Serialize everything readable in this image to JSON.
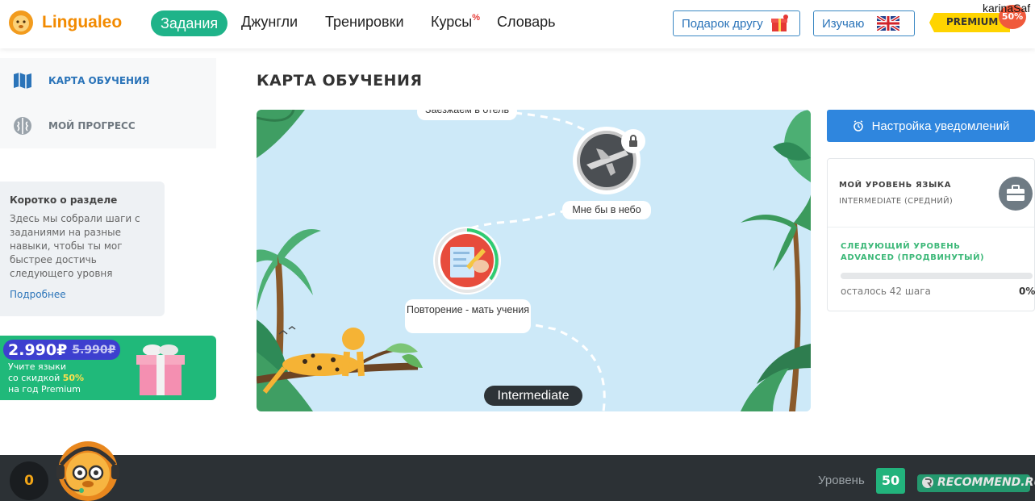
{
  "header": {
    "logo_text": "Lingualeo",
    "nav": [
      {
        "label": "Задания"
      },
      {
        "label": "Джунгли"
      },
      {
        "label": "Тренировки"
      },
      {
        "label": "Курсы",
        "badge": "%"
      },
      {
        "label": "Словарь"
      }
    ],
    "gift_button": "Подарок другу",
    "learning_button": "Изучаю",
    "premium_label": "PREMIUM",
    "premium_discount": "50%",
    "username": "karinaSaf"
  },
  "sidebar": {
    "items": [
      {
        "label": "КАРТА ОБУЧЕНИЯ",
        "icon": "map-icon",
        "active": true
      },
      {
        "label": "МОЙ ПРОГРЕСС",
        "icon": "brain-icon",
        "active": false
      }
    ],
    "about": {
      "title": "Коротко о разделе",
      "text": "Здесь мы собрали шаги с заданиями на разные навыки, чтобы ты мог быстрее достичь следующего уровня",
      "more_link": "Подробнее"
    },
    "promo": {
      "price": "2.990₽",
      "old_price": "5.990₽",
      "line1": "Учите языки",
      "line2_prefix": "со скидкой ",
      "line2_highlight": "50%",
      "line3": "на год Premium"
    }
  },
  "main": {
    "title": "КАРТА ОБУЧЕНИЯ",
    "map": {
      "steps": [
        {
          "label": "Заезжаем в отель"
        },
        {
          "label": "Мне бы в небо",
          "locked": true
        },
        {
          "label": "Повторение - мать учения"
        }
      ],
      "level_label": "Intermediate"
    }
  },
  "right_panel": {
    "notify_button": "Настройка уведомлений",
    "my_level_title": "МОЙ УРОВЕНЬ ЯЗЫКА",
    "my_level_value": "INTERMEDIATE (СРЕДНИЙ)",
    "next_level_title": "СЛЕДУЮЩИЙ УРОВЕНЬ",
    "next_level_value": "ADVANCED (ПРОДВИНУТЫЙ)",
    "steps_left": "осталось 42 шага",
    "progress_percent": "0%",
    "progress_fraction": 0
  },
  "footer": {
    "coins": "0",
    "level_label": "Уровень",
    "level_value": "50",
    "watermark": "RECOMMEND.RU"
  },
  "colors": {
    "brand_green": "#1fb389",
    "brand_orange": "#f28a00",
    "link_blue": "#2b74b9",
    "button_blue": "#2f86de",
    "footer_dark": "#2c3135"
  }
}
